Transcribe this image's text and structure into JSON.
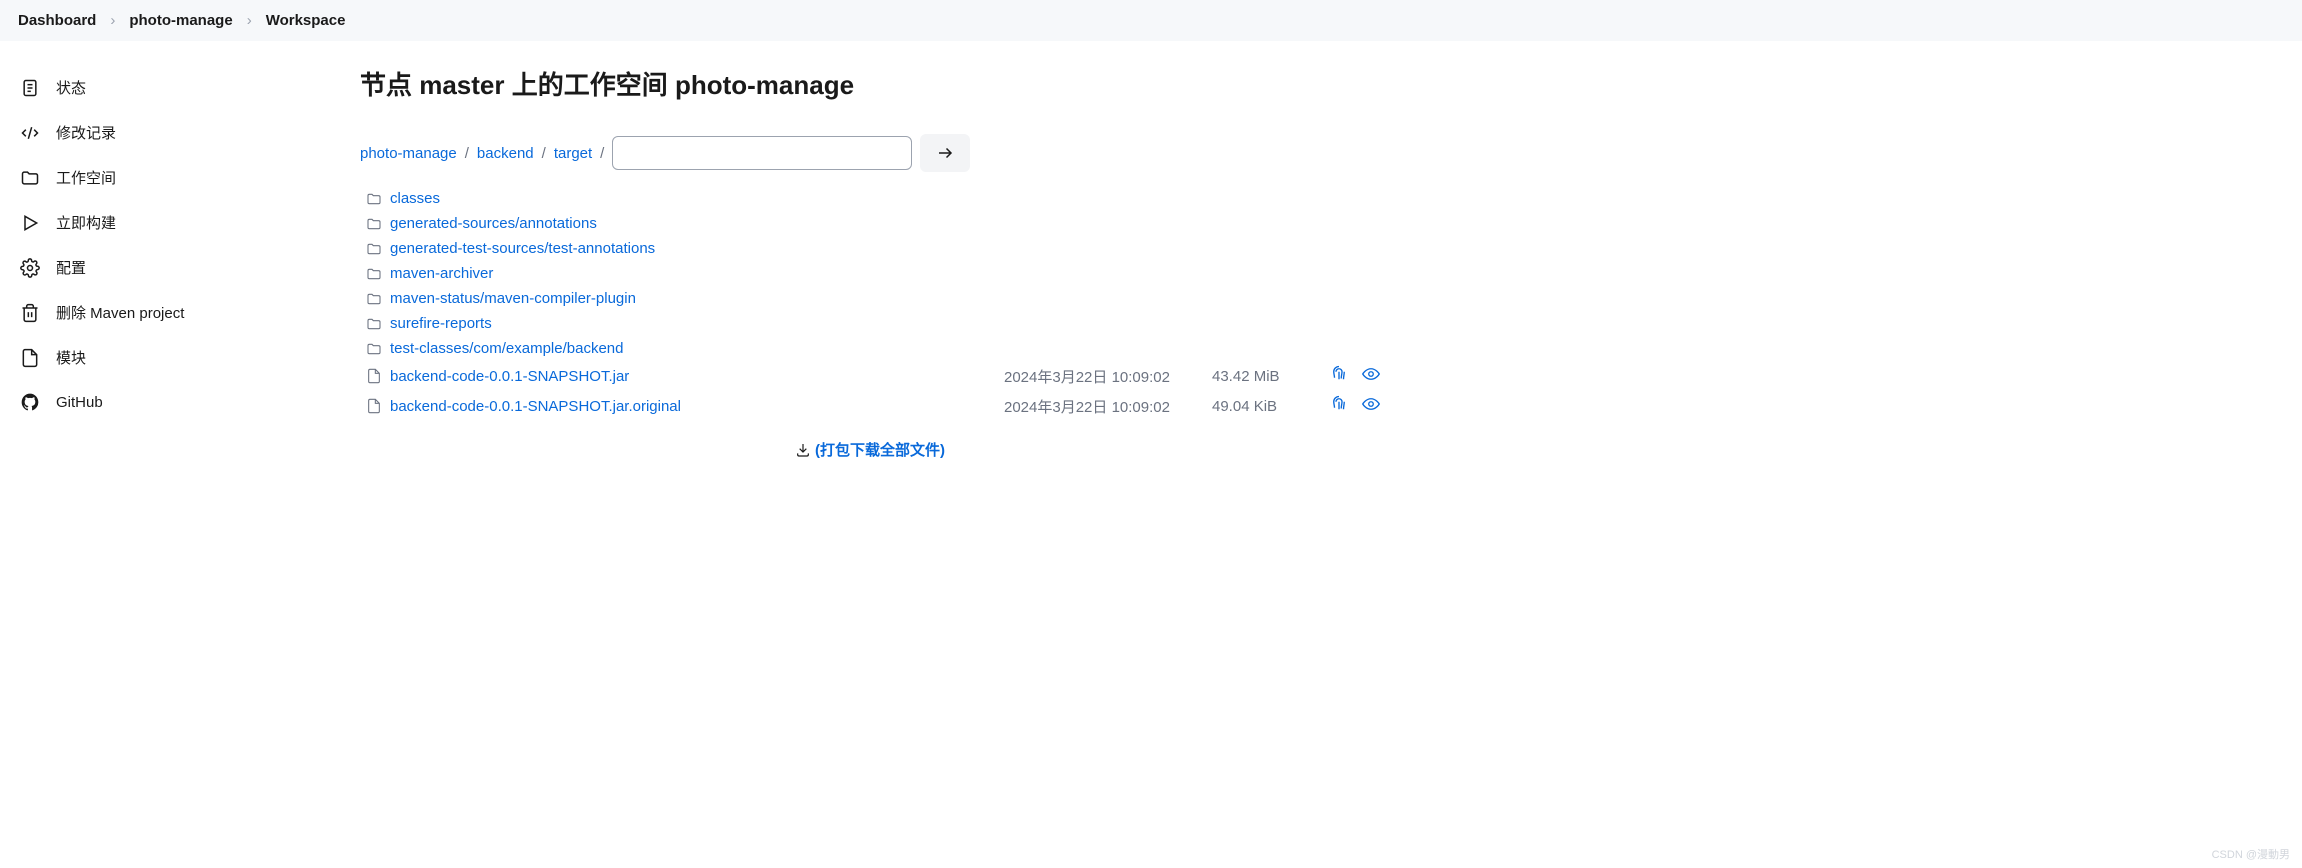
{
  "breadcrumb": {
    "items": [
      "Dashboard",
      "photo-manage",
      "Workspace"
    ]
  },
  "sidebar": {
    "items": [
      {
        "label": "状态"
      },
      {
        "label": "修改记录"
      },
      {
        "label": "工作空间"
      },
      {
        "label": "立即构建"
      },
      {
        "label": "配置"
      },
      {
        "label": "删除 Maven project"
      },
      {
        "label": "模块"
      },
      {
        "label": "GitHub"
      }
    ]
  },
  "main": {
    "title": "节点 master 上的工作空间 photo-manage",
    "path": {
      "segments": [
        "photo-manage",
        "backend",
        "target"
      ],
      "input_value": ""
    },
    "folders": [
      {
        "parts": [
          "classes"
        ]
      },
      {
        "parts": [
          "generated-sources",
          "annotations"
        ]
      },
      {
        "parts": [
          "generated-test-sources",
          "test-annotations"
        ]
      },
      {
        "parts": [
          "maven-archiver"
        ]
      },
      {
        "parts": [
          "maven-status",
          "maven-compiler-plugin"
        ]
      },
      {
        "parts": [
          "surefire-reports"
        ]
      },
      {
        "parts": [
          "test-classes",
          "com",
          "example",
          "backend"
        ]
      }
    ],
    "files": [
      {
        "name": "backend-code-0.0.1-SNAPSHOT.jar",
        "date": "2024年3月22日 10:09:02",
        "size": "43.42 MiB"
      },
      {
        "name": "backend-code-0.0.1-SNAPSHOT.jar.original",
        "date": "2024年3月22日 10:09:02",
        "size": "49.04 KiB"
      }
    ],
    "download_all": "(打包下载全部文件)"
  },
  "watermark": "CSDN @漫動男"
}
